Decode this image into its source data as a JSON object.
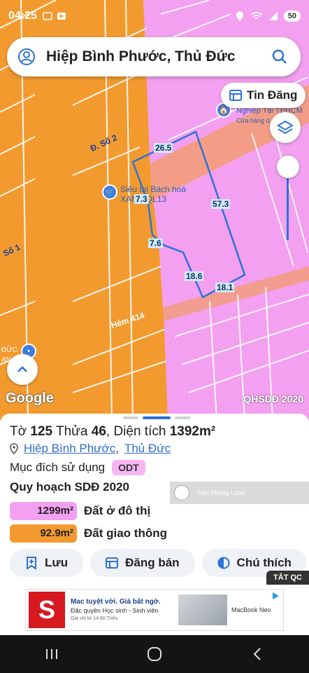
{
  "status_bar": {
    "time": "04:25",
    "battery": "50"
  },
  "search": {
    "query": "Hiệp Bình Phước, Thủ Đức"
  },
  "map": {
    "post_button_label": "Tin Đăng",
    "streets": {
      "so2": "Đ. Số 2",
      "so1": "Số 1",
      "hem414": "Hẻm 414"
    },
    "poi": {
      "supermarket_line1": "Siêu thị Bách hoá",
      "supermarket_line2": "XANH QL13",
      "business_line1": "Nghiệp Tại TPHCM",
      "business_line2": "Cửa hàng d",
      "left_line1": "ĐỨC",
      "left_line2": "AN"
    },
    "dimensions": [
      "26.5",
      "57.3",
      "7.6",
      "18.6",
      "18.1",
      "7.3"
    ],
    "attribution": "Google",
    "layer_label": "QHSDĐ 2020"
  },
  "parcel": {
    "to_label": "Tờ",
    "to_value": "125",
    "thua_label": "Thửa",
    "thua_value": "46",
    "area_label": "Diện tích",
    "area_value": "1392m²",
    "ward": "Hiệp Bình Phước",
    "district": "Thủ Đức",
    "purpose_label": "Mục đích sử dụng",
    "purpose_code": "ODT",
    "plan_title": "Quy hoạch SDĐ 2020",
    "zones": [
      {
        "area": "1299m²",
        "label": "Đất ở đô thị",
        "color": "#f3a0f0"
      },
      {
        "area": "92.9m²",
        "label": "Đất giao thông",
        "color": "#f39a2f"
      }
    ],
    "watermark": "Trần Phong Land"
  },
  "actions": {
    "save": "Lưu",
    "post": "Đăng bán",
    "legend": "Chú thích"
  },
  "ad": {
    "close_label": "TẮT QC",
    "headline": "Mac tuyệt vời. Giá bất ngờ.",
    "subline": "Đặc quyền Học sinh - Sinh viên",
    "price": "Giá chỉ từ 14.60 Triệu",
    "brand": "MacBook Neo"
  },
  "colors": {
    "residential": "#f3a0f0",
    "transport": "#f39a2f",
    "accent": "#2f72d8"
  }
}
